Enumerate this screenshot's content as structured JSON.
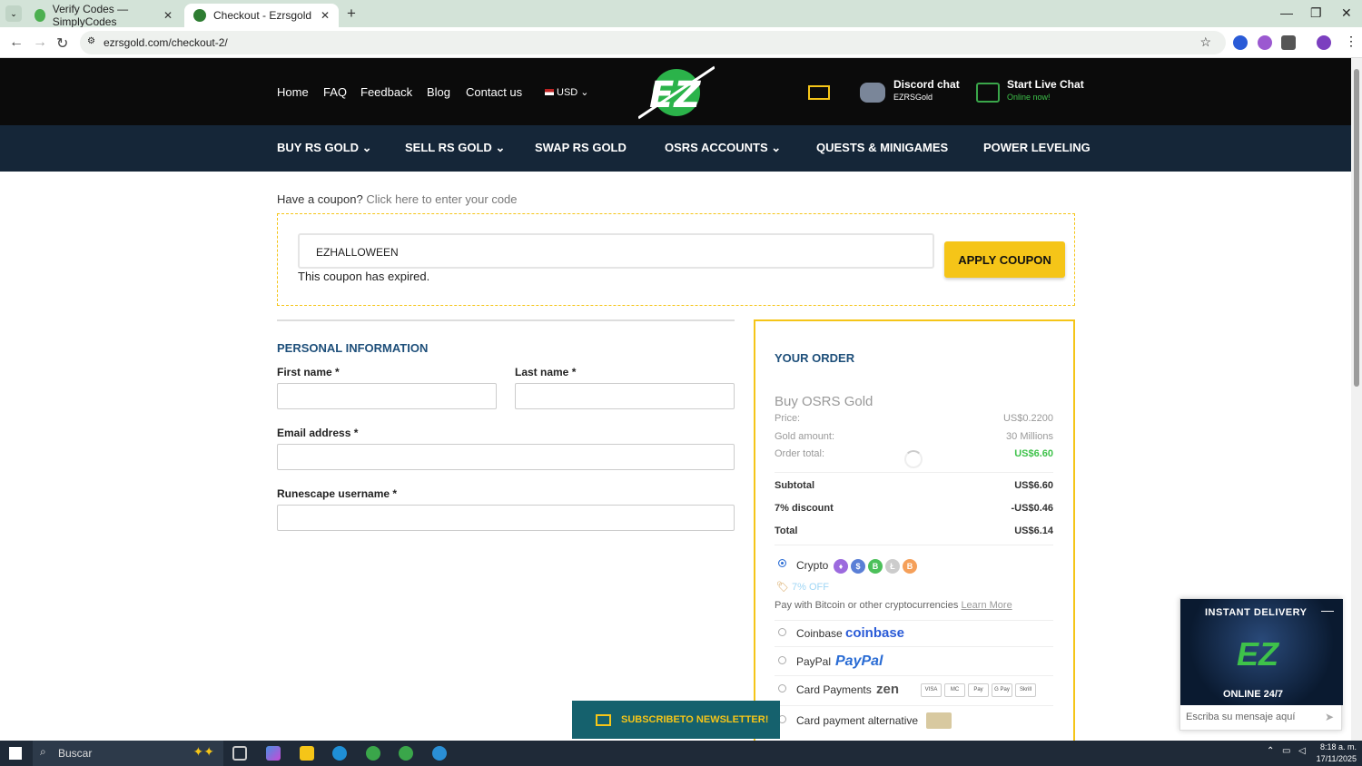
{
  "browser": {
    "tabs": [
      {
        "title": "Verify Codes — SimplyCodes"
      },
      {
        "title": "Checkout - Ezrsgold"
      }
    ],
    "url": "ezrsgold.com/checkout-2/",
    "new_tab": "+"
  },
  "site": {
    "topnav": [
      "Home",
      "FAQ",
      "Feedback",
      "Blog",
      "Contact us"
    ],
    "currency": "USD",
    "discord": {
      "title": "Discord chat",
      "sub": "EZRSGold"
    },
    "livechat": {
      "title": "Start Live Chat",
      "sub": "Online now!"
    },
    "menu": [
      "BUY RS GOLD",
      "SELL RS GOLD",
      "SWAP RS GOLD",
      "OSRS ACCOUNTS",
      "QUESTS & MINIGAMES",
      "POWER LEVELING"
    ]
  },
  "coupon": {
    "question": "Have a coupon?",
    "link": "Click here to enter your code",
    "code": "EZHALLOWEEN",
    "error": "This coupon has expired.",
    "apply": "APPLY COUPON"
  },
  "personal": {
    "title": "PERSONAL INFORMATION",
    "first_name": "First name *",
    "last_name": "Last name *",
    "email": "Email address *",
    "username": "Runescape username *"
  },
  "order": {
    "title": "YOUR ORDER",
    "product": "Buy OSRS Gold",
    "price_label": "Price:",
    "price": "US$0.2200",
    "amount_label": "Gold amount:",
    "amount": "30 Millions",
    "ordertotal_label": "Order total:",
    "ordertotal": "US$6.60",
    "subtotal_label": "Subtotal",
    "subtotal": "US$6.60",
    "discount_label": "7% discount",
    "discount": "-US$0.46",
    "total_label": "Total",
    "total": "US$6.14",
    "payments": {
      "crypto": "Crypto",
      "crypto_off": "7% OFF",
      "crypto_note": "Pay with Bitcoin or other cryptocurrencies",
      "learn_more": "Learn More",
      "coinbase": "Coinbase",
      "coinbase_brand": "coinbase",
      "paypal": "PayPal",
      "paypal_brand": "PayPal",
      "card": "Card Payments",
      "zen_brand": "zen",
      "card_brands": [
        "VISA",
        "MC",
        "Pay",
        "G Pay",
        "Skrill"
      ],
      "card_alt": "Card payment alternative"
    }
  },
  "newsletter": "SUBSCRIBETO NEWSLETTER!",
  "chat_widget": {
    "banner_top": "INSTANT DELIVERY",
    "logo": "EZ",
    "banner_bottom": "ONLINE 24/7",
    "placeholder": "Escriba su mensaje aquí"
  },
  "taskbar": {
    "search": "Buscar",
    "time": "8:18 a. m.",
    "date": "17/11/2025"
  }
}
